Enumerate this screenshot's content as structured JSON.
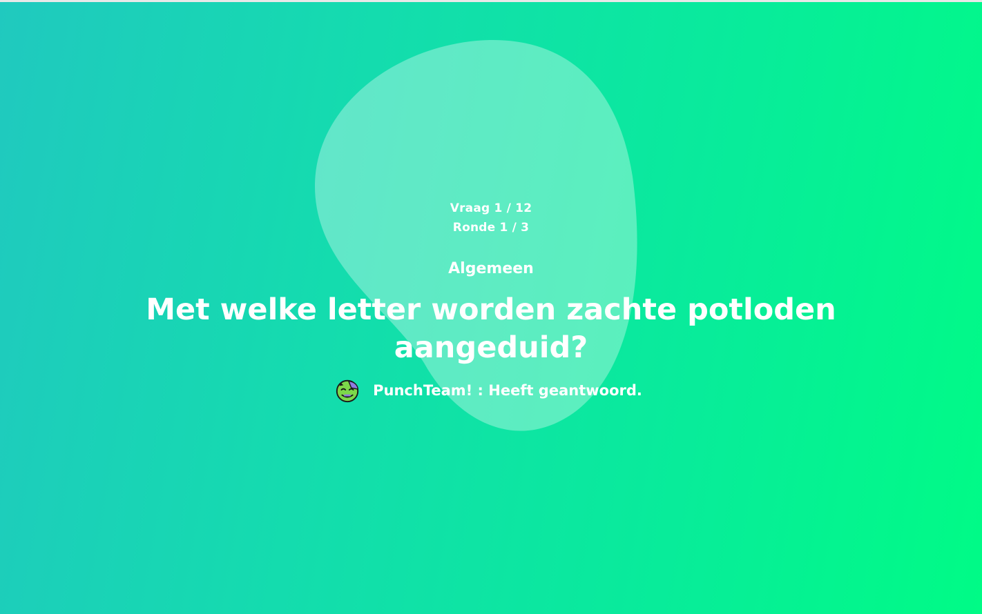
{
  "quiz": {
    "question_counter": "Vraag 1 / 12",
    "round_counter": "Ronde 1 / 3",
    "category": "Algemeen",
    "question": "Met welke letter worden zachte potloden aangeduid?"
  },
  "answers": [
    {
      "team": "PunchTeam!",
      "separator": " : ",
      "status": "Heeft geantwoord.",
      "avatar_icon": "zombie-face-icon"
    }
  ],
  "colors": {
    "background_start": "#20c9bf",
    "background_end": "#00fb86",
    "blob": "#ffffff",
    "text": "#ffffff"
  }
}
